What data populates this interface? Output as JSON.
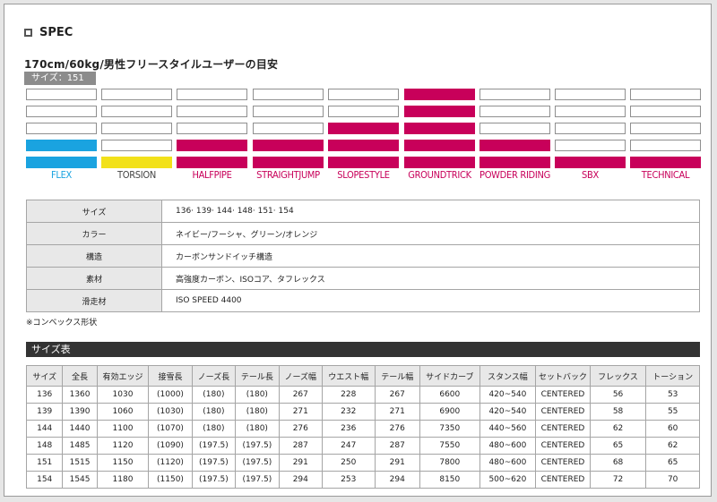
{
  "spec": {
    "title": "SPEC"
  },
  "subtitle": "170cm/60kg/男性フリースタイルユーザーの目安",
  "size_badge": "サイズ：151",
  "meters": [
    {
      "label": "FLEX",
      "level": 2,
      "fill": "#1aa3e0",
      "text_color": "#1aa3e0"
    },
    {
      "label": "TORSION",
      "level": 1,
      "fill": "#f2e11a",
      "text_color": "#444444"
    },
    {
      "label": "HALFPIPE",
      "level": 2,
      "fill": "#c8005a",
      "text_color": "#c8005a"
    },
    {
      "label": "STRAIGHTJUMP",
      "level": 2,
      "fill": "#c8005a",
      "text_color": "#c8005a"
    },
    {
      "label": "SLOPESTYLE",
      "level": 3,
      "fill": "#c8005a",
      "text_color": "#c8005a"
    },
    {
      "label": "GROUNDTRICK",
      "level": 5,
      "fill": "#c8005a",
      "text_color": "#c8005a"
    },
    {
      "label": "POWDER RIDING",
      "level": 2,
      "fill": "#c8005a",
      "text_color": "#c8005a"
    },
    {
      "label": "SBX",
      "level": 1,
      "fill": "#c8005a",
      "text_color": "#c8005a"
    },
    {
      "label": "TECHNICAL",
      "level": 1,
      "fill": "#c8005a",
      "text_color": "#c8005a"
    }
  ],
  "spec_rows": [
    {
      "label": "サイズ",
      "value": "136· 139· 144· 148· 151· 154"
    },
    {
      "label": "カラー",
      "value": "ネイビー/フーシャ、グリーン/オレンジ"
    },
    {
      "label": "構造",
      "value": "カーボンサンドイッチ構造"
    },
    {
      "label": "素材",
      "value": "高強度カーボン、ISOコア、タフレックス"
    },
    {
      "label": "滑走材",
      "value": "ISO SPEED 4400"
    }
  ],
  "note": "※コンベックス形状",
  "size_chart": {
    "title": "サイズ表",
    "headers": [
      "サイズ",
      "全長",
      "有効エッジ",
      "接雪長",
      "ノーズ長",
      "テール長",
      "ノーズ幅",
      "ウエスト幅",
      "テール幅",
      "サイドカーブ",
      "スタンス幅",
      "セットバック",
      "フレックス",
      "トーション"
    ],
    "rows": [
      [
        "136",
        "1360",
        "1030",
        "(1000)",
        "(180)",
        "(180)",
        "267",
        "228",
        "267",
        "6600",
        "420~540",
        "CENTERED",
        "56",
        "53"
      ],
      [
        "139",
        "1390",
        "1060",
        "(1030)",
        "(180)",
        "(180)",
        "271",
        "232",
        "271",
        "6900",
        "420~540",
        "CENTERED",
        "58",
        "55"
      ],
      [
        "144",
        "1440",
        "1100",
        "(1070)",
        "(180)",
        "(180)",
        "276",
        "236",
        "276",
        "7350",
        "440~560",
        "CENTERED",
        "62",
        "60"
      ],
      [
        "148",
        "1485",
        "1120",
        "(1090)",
        "(197.5)",
        "(197.5)",
        "287",
        "247",
        "287",
        "7550",
        "480~600",
        "CENTERED",
        "65",
        "62"
      ],
      [
        "151",
        "1515",
        "1150",
        "(1120)",
        "(197.5)",
        "(197.5)",
        "291",
        "250",
        "291",
        "7800",
        "480~600",
        "CENTERED",
        "68",
        "65"
      ],
      [
        "154",
        "1545",
        "1180",
        "(1150)",
        "(197.5)",
        "(197.5)",
        "294",
        "253",
        "294",
        "8150",
        "500~620",
        "CENTERED",
        "72",
        "70"
      ]
    ]
  }
}
